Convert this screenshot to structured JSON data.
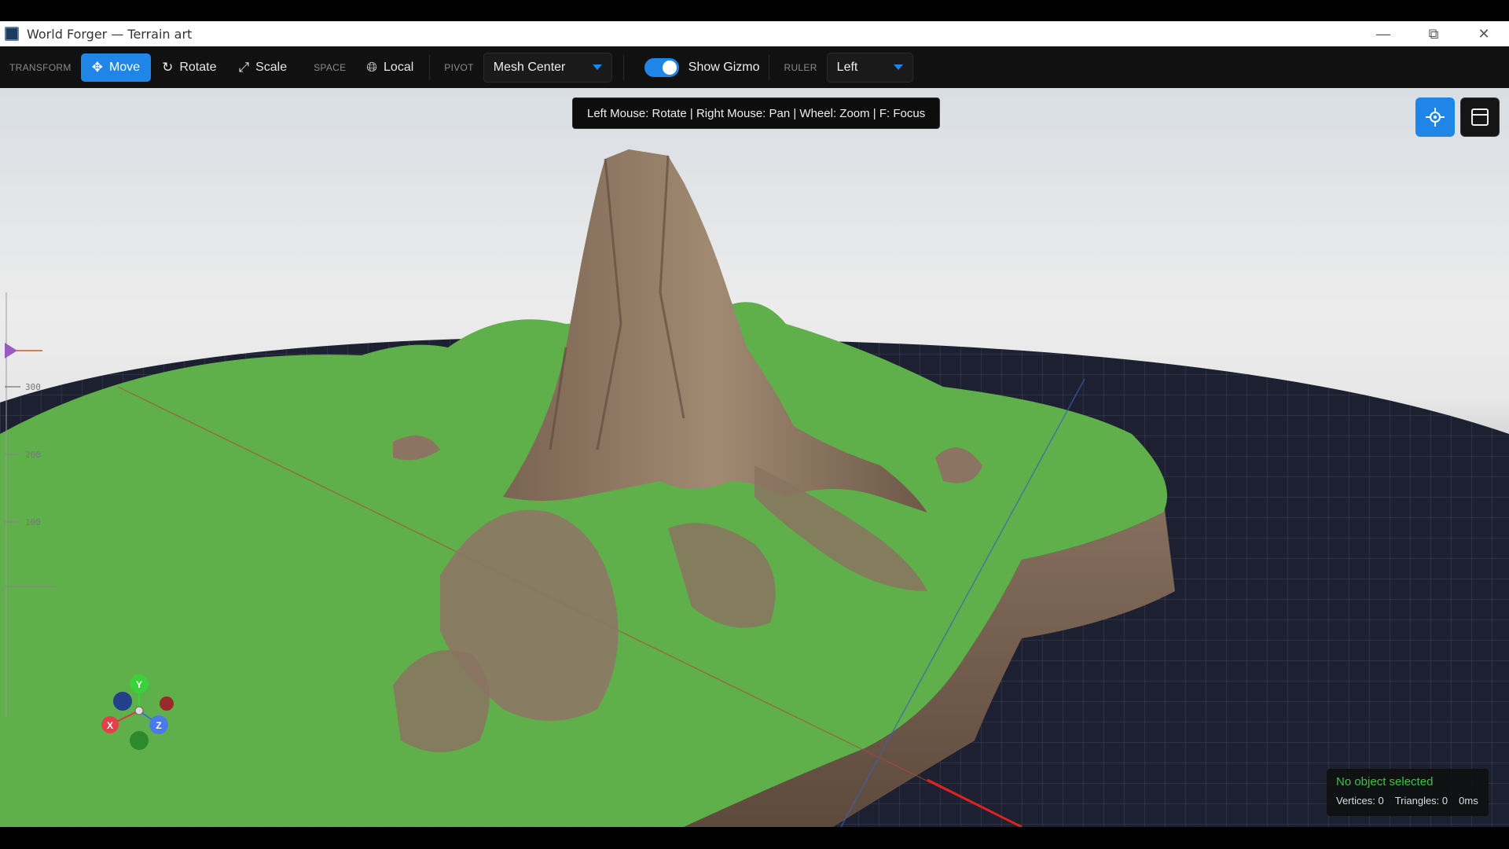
{
  "window": {
    "title": "World Forger — Terrain art",
    "min_icon": "minimize-icon",
    "max_icon": "restore-icon",
    "close_icon": "close-icon"
  },
  "toolbar": {
    "transform_label": "TRANSFORM",
    "move_label": "Move",
    "rotate_label": "Rotate",
    "scale_label": "Scale",
    "space_label": "SPACE",
    "local_label": "Local",
    "pivot_label": "PIVOT",
    "pivot_value": "Mesh Center",
    "show_gizmo_label": "Show Gizmo",
    "show_gizmo_on": true,
    "ruler_label": "RULER",
    "ruler_value": "Left",
    "accent_color": "#1f86e8"
  },
  "viewport": {
    "hint": "Left Mouse: Rotate | Right Mouse: Pan | Wheel: Zoom | F: Focus",
    "focus_button_icon": "crosshair-icon",
    "layout_button_icon": "layout-panel-icon",
    "ruler_ticks": [
      "300",
      "200",
      "100"
    ],
    "gizmo_axes": {
      "x": "X",
      "y": "Y",
      "z": "Z"
    }
  },
  "status": {
    "selection": "No object selected",
    "vertices": "Vertices: 0",
    "triangles": "Triangles: 0",
    "time": "0ms"
  }
}
